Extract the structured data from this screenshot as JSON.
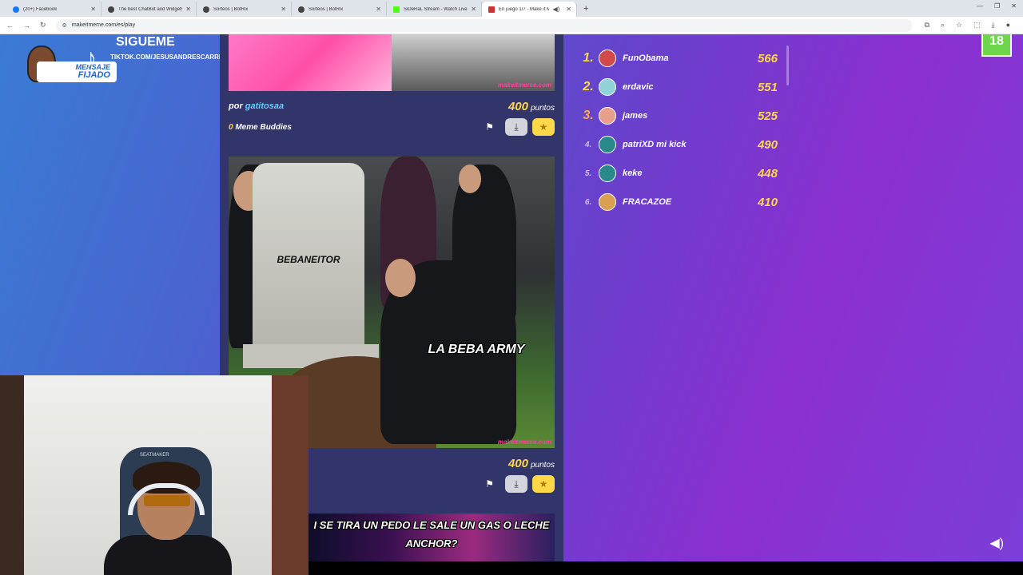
{
  "browser": {
    "tabs": [
      {
        "label": "(20+) Facebook",
        "fav_color": "#1877f2",
        "active": false
      },
      {
        "label": "The best ChatBot and Widgets",
        "fav_color": "#444",
        "active": false
      },
      {
        "label": "Sorteos | BotRix",
        "fav_color": "#444",
        "active": false
      },
      {
        "label": "Sorteos | BotRix",
        "fav_color": "#444",
        "active": false
      },
      {
        "label": "SiDeRaL Stream - Watch Live o",
        "fav_color": "#53fc18",
        "active": false
      },
      {
        "label": "En juego 1/7 - Make it Mer",
        "fav_color": "#c33",
        "active": true
      }
    ],
    "new_tab": "+",
    "url": "makeitmeme.com/es/play"
  },
  "overlay": {
    "sigueme": "SIGUEME",
    "tiktok_handle": "TIKTOK.COM/JESUSANDRESCARRION",
    "pinned_label_1": "MENSAJE",
    "pinned_label_2": "FIJADO",
    "chair_brand": "SEATMAKER"
  },
  "feed": {
    "meme1": {
      "watermark": "makeitmeme.com",
      "by_prefix": "por",
      "author": "gatitosaa",
      "points": "400",
      "points_label": "puntos",
      "buddies_count": "0",
      "buddies_label": "Meme Buddies"
    },
    "meme2": {
      "tomb_text": "BEBANEITOR",
      "caption": "LA BEBA ARMY",
      "watermark": "makeitmeme.com",
      "points": "400",
      "points_label": "puntos"
    },
    "meme3": {
      "caption_1": "I SE TIRA UN PEDO LE SALE UN GAS O LECHE",
      "caption_2": "ANCHOR?"
    }
  },
  "leaderboard": [
    {
      "rank": "1.",
      "name": "FunObama",
      "score": "566",
      "color": "#d04a4a"
    },
    {
      "rank": "2.",
      "name": "erdavic",
      "score": "551",
      "color": "#8fd3d8"
    },
    {
      "rank": "3.",
      "name": "james",
      "score": "525",
      "color": "#e8a08a"
    },
    {
      "rank": "4.",
      "name": "patriXD mi kick",
      "score": "490",
      "color": "#2a8a8a"
    },
    {
      "rank": "5.",
      "name": "keke",
      "score": "448",
      "color": "#2a8a8a"
    },
    {
      "rank": "6.",
      "name": "FRACAZOE",
      "score": "410",
      "color": "#d8a050"
    }
  ],
  "age_badge": "18",
  "colors": {
    "accent_gold": "#ffd84a",
    "author_blue": "#5fd0ff"
  }
}
